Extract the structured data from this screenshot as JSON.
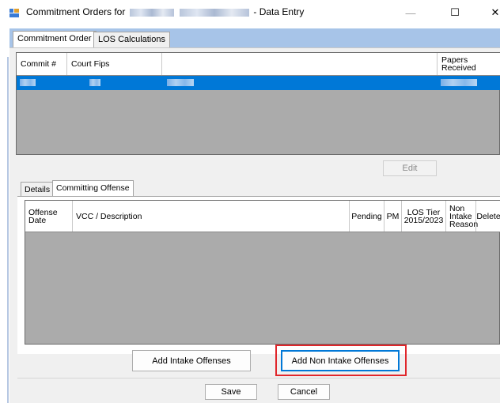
{
  "window": {
    "title_prefix": "Commitment Orders for",
    "title_suffix": "- Data Entry",
    "minimize_glyph": "—",
    "maximize_glyph": "☐",
    "close_glyph": "✕"
  },
  "outer_tabs": [
    {
      "label": "Commitment Order",
      "active": true
    },
    {
      "label": "LOS Calculations",
      "active": false
    }
  ],
  "commitments_grid": {
    "columns": [
      "Commit #",
      "Court Fips",
      "",
      "Papers Received"
    ],
    "selected_row_redacted": true
  },
  "edit_button": {
    "label": "Edit",
    "enabled": false
  },
  "inner_tabs": [
    {
      "label": "Details",
      "active": false
    },
    {
      "label": "Committing Offense",
      "active": true
    }
  ],
  "offense_grid": {
    "columns": [
      "Offense Date",
      "VCC / Description",
      "Pending",
      "PM",
      "LOS Tier 2015/2023",
      "Non Intake Reason",
      "Delete"
    ]
  },
  "buttons": {
    "add_intake": "Add Intake Offenses",
    "add_non_intake": "Add Non Intake Offenses",
    "save": "Save",
    "cancel": "Cancel"
  },
  "colors": {
    "selection": "#0078d7",
    "tab_strip": "#a7c4e8",
    "grid_empty": "#ababab",
    "highlight_box": "#e0262b"
  }
}
